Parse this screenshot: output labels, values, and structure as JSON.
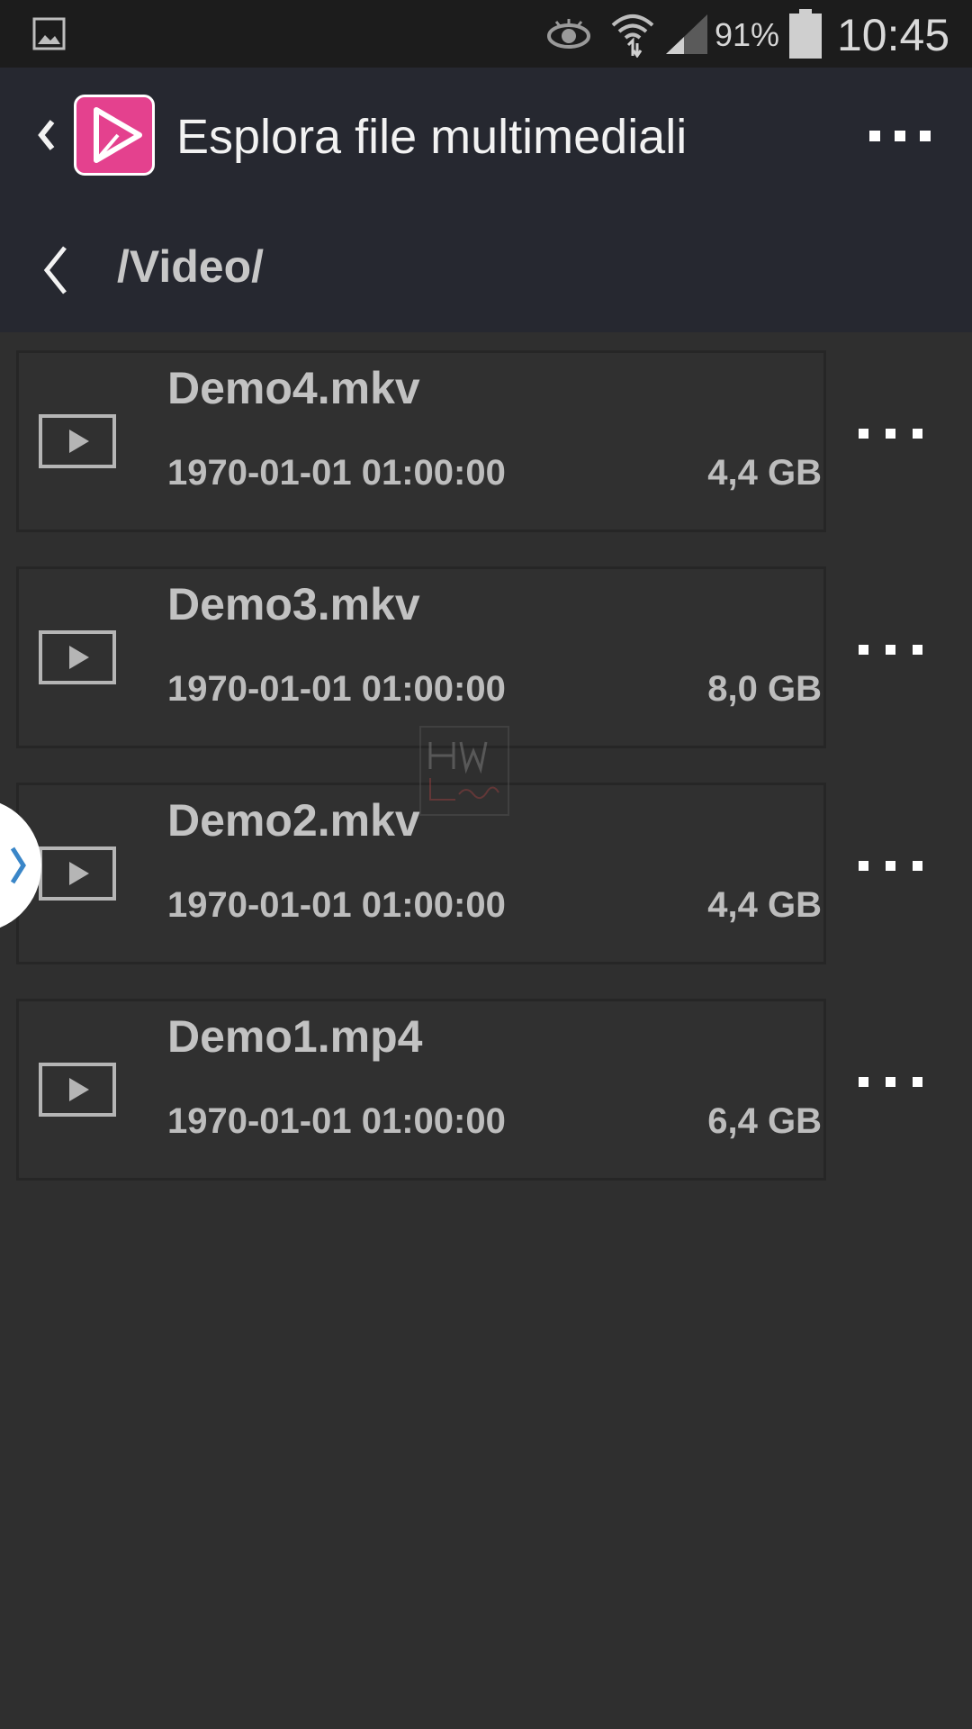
{
  "status_bar": {
    "battery_level": "91%",
    "time": "10:45",
    "icons": [
      "gallery-icon",
      "eye-icon",
      "wifi-icon",
      "signal-icon",
      "battery-icon"
    ]
  },
  "app_bar": {
    "title": "Esplora file multimediali",
    "icons": [
      "back-icon",
      "app-logo",
      "overflow-menu-icon"
    ],
    "logo_color": "#e4418e"
  },
  "path_bar": {
    "path": "/Video/"
  },
  "files": [
    {
      "name": "Demo4.mkv",
      "date": "1970-01-01 01:00:00",
      "size": "4,4 GB"
    },
    {
      "name": "Demo3.mkv",
      "date": "1970-01-01 01:00:00",
      "size": "8,0 GB"
    },
    {
      "name": "Demo2.mkv",
      "date": "1970-01-01 01:00:00",
      "size": "4,4 GB"
    },
    {
      "name": "Demo1.mp4",
      "date": "1970-01-01 01:00:00",
      "size": "6,4 GB"
    }
  ],
  "colors": {
    "background": "#2f2f2f",
    "app_bar": "#262830",
    "status_bar": "#1c1c1c",
    "accent_handle": "#3a86c8"
  }
}
